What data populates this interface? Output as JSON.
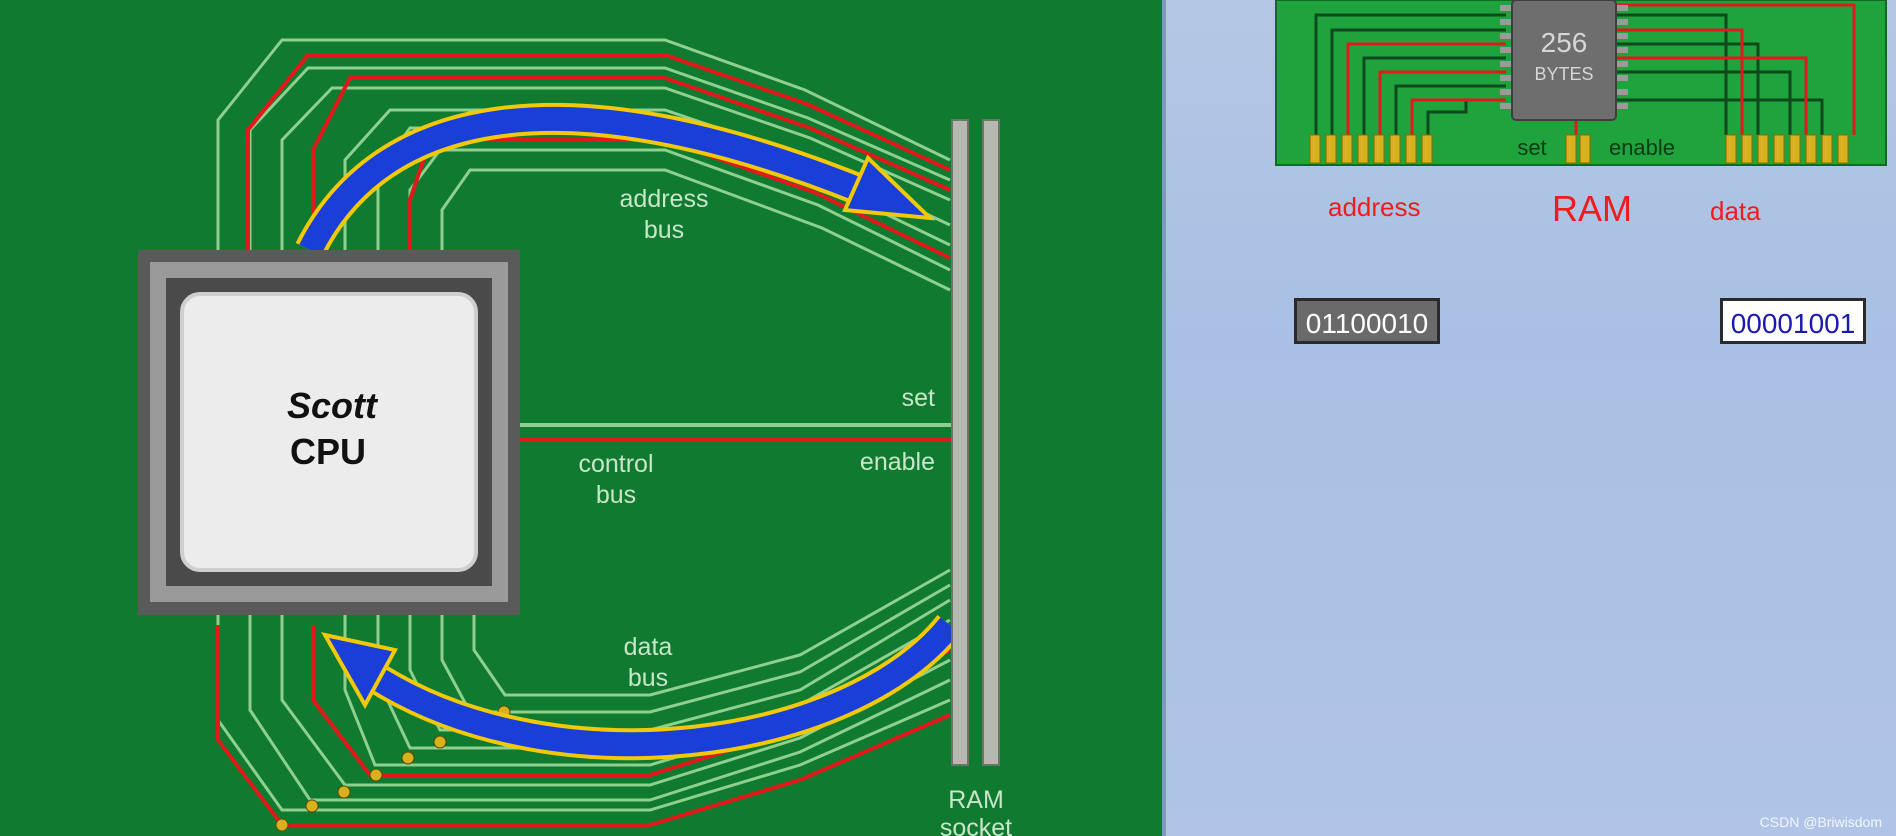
{
  "diagram": {
    "cpu": {
      "line1": "Scott",
      "line2": "CPU"
    },
    "buses": {
      "address_line1": "address",
      "address_line2": "bus",
      "control_line1": "control",
      "control_line2": "bus",
      "data_line1": "data",
      "data_line2": "bus",
      "set": "set",
      "enable": "enable"
    },
    "socket": {
      "line1": "RAM",
      "line2": "socket"
    }
  },
  "ram_panel": {
    "chip_size": "256",
    "chip_unit": "BYTES",
    "set": "set",
    "enable": "enable",
    "address_label": "address",
    "ram_label": "RAM",
    "data_label": "data",
    "address_value": "01100010",
    "data_value": "00001001"
  },
  "watermark": "CSDN @Briwisdom",
  "colors": {
    "board_green": "#0f7a30",
    "trace_light": "#8fd08f",
    "trace_red": "#e01a1a",
    "arrow_blue": "#1a3fd6",
    "arrow_outline": "#f2c80a",
    "annotation_red": "#ee1c1c"
  }
}
